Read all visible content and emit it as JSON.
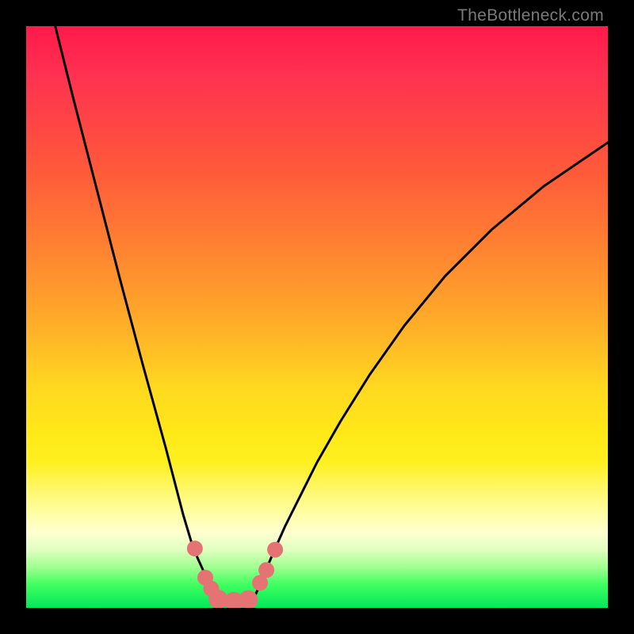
{
  "watermark": "TheBottleneck.com",
  "chart_data": {
    "type": "line",
    "title": "",
    "xlabel": "",
    "ylabel": "",
    "xlim": [
      0,
      100
    ],
    "ylim": [
      0,
      100
    ],
    "series": [
      {
        "name": "left-curve",
        "x": [
          5,
          8,
          12,
          16,
          20,
          24,
          27,
          28.5,
          29.5,
          30.5,
          31,
          31.8,
          32.5,
          33
        ],
        "y": [
          100,
          88,
          72.5,
          57,
          42,
          27.5,
          16,
          11,
          8.5,
          6.3,
          5,
          3.3,
          1.5,
          0
        ]
      },
      {
        "name": "right-curve",
        "x": [
          38.5,
          39.2,
          40,
          41,
          42.5,
          44.5,
          47,
          50,
          54,
          59,
          65,
          72,
          80,
          89,
          100
        ],
        "y": [
          0,
          1.8,
          3.5,
          6,
          9.5,
          14,
          19,
          25,
          32,
          40,
          48.5,
          57,
          65,
          72.5,
          80
        ]
      }
    ],
    "markers": {
      "name": "dots",
      "color": "#e57373",
      "points": [
        {
          "x": 29.0,
          "y": 10.2,
          "r": 10
        },
        {
          "x": 30.8,
          "y": 5.2,
          "r": 10
        },
        {
          "x": 31.8,
          "y": 3.3,
          "r": 10
        },
        {
          "x": 33.0,
          "y": 1.5,
          "r": 12
        },
        {
          "x": 35.7,
          "y": 1.1,
          "r": 12
        },
        {
          "x": 38.2,
          "y": 1.4,
          "r": 12
        },
        {
          "x": 40.2,
          "y": 4.3,
          "r": 10
        },
        {
          "x": 41.3,
          "y": 6.5,
          "r": 10
        },
        {
          "x": 42.8,
          "y": 10.0,
          "r": 10
        }
      ]
    }
  }
}
